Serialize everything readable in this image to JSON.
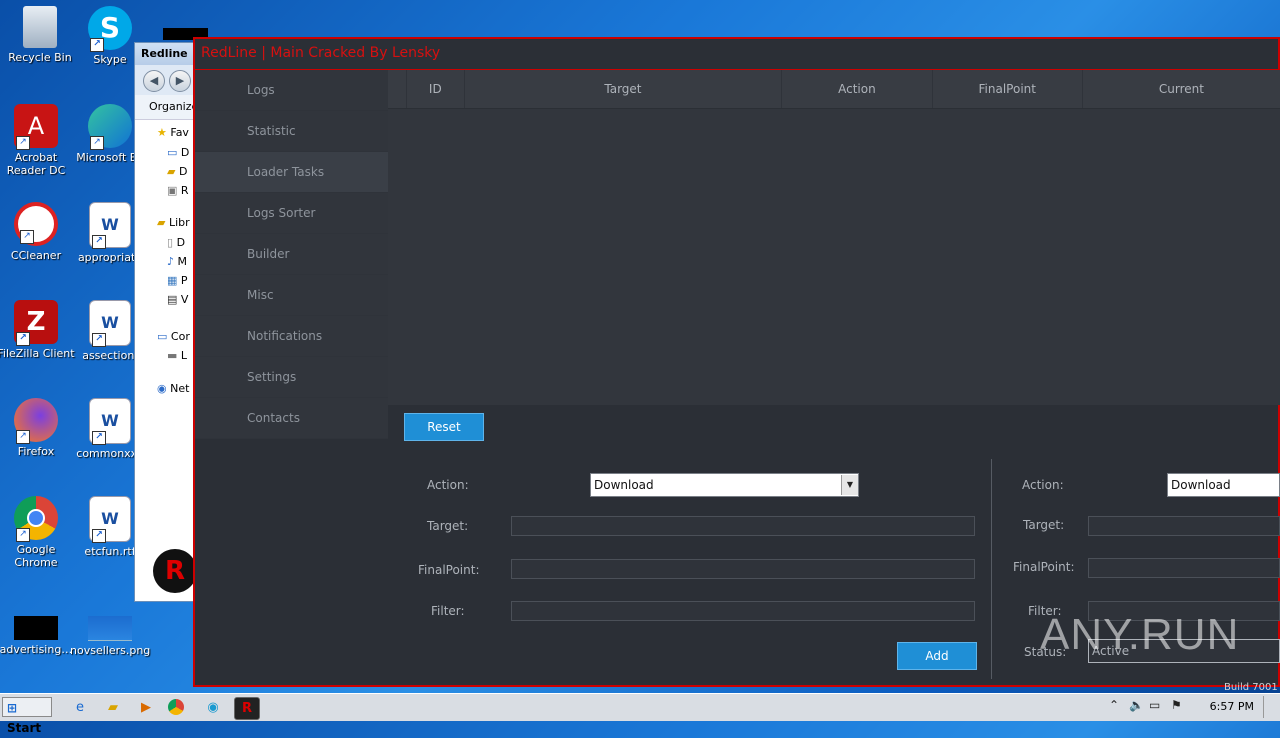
{
  "desktop": {
    "icons": [
      {
        "label": "Recycle Bin",
        "icon": "recycle-bin-icon"
      },
      {
        "label": "Skype",
        "icon": "skype-icon"
      },
      {
        "label": "Acrobat Reader DC",
        "icon": "acrobat-icon"
      },
      {
        "label": "Microsoft Ed",
        "icon": "edge-icon"
      },
      {
        "label": "CCleaner",
        "icon": "ccleaner-icon"
      },
      {
        "label": "appropriate",
        "icon": "word-doc-icon"
      },
      {
        "label": "FileZilla Client",
        "icon": "filezilla-icon"
      },
      {
        "label": "assection.",
        "icon": "word-doc-icon"
      },
      {
        "label": "Firefox",
        "icon": "firefox-icon"
      },
      {
        "label": "commonxxx",
        "icon": "word-doc-icon"
      },
      {
        "label": "Google Chrome",
        "icon": "chrome-icon"
      },
      {
        "label": "etcfun.rtf",
        "icon": "word-doc-icon"
      },
      {
        "label": "advertising…",
        "icon": "file-icon"
      },
      {
        "label": "novsellers.png",
        "icon": "image-icon"
      }
    ]
  },
  "explorer": {
    "title": "Redline",
    "organize": "Organize",
    "tree": [
      "Fav",
      "D",
      "D",
      "R",
      "Libr",
      "D",
      "M",
      "P",
      "V",
      "Cor",
      "L",
      "Net"
    ]
  },
  "app": {
    "title": "RedLine | Main Cracked By Lensky",
    "sidebar": [
      "Logs",
      "Statistic",
      "Loader Tasks",
      "Logs Sorter",
      "Builder",
      "Misc",
      "Notifications",
      "Settings",
      "Contacts"
    ],
    "active_item": "Loader Tasks",
    "columns": [
      "ID",
      "Target",
      "Action",
      "FinalPoint",
      "Current"
    ],
    "reset_label": "Reset",
    "add_label": "Add",
    "left_form": {
      "action_label": "Action:",
      "action_value": "Download",
      "target_label": "Target:",
      "finalpoint_label": "FinalPoint:",
      "filter_label": "Filter:"
    },
    "right_form": {
      "action_label": "Action:",
      "action_value": "Download",
      "target_label": "Target:",
      "finalpoint_label": "FinalPoint:",
      "filter_label": "Filter:",
      "status_label": "Status:",
      "status_value": "Active"
    },
    "build_text": "Build 7001"
  },
  "taskbar": {
    "start_label": "Start",
    "clock": "6:57 PM"
  },
  "watermark": "ANY.RUN"
}
